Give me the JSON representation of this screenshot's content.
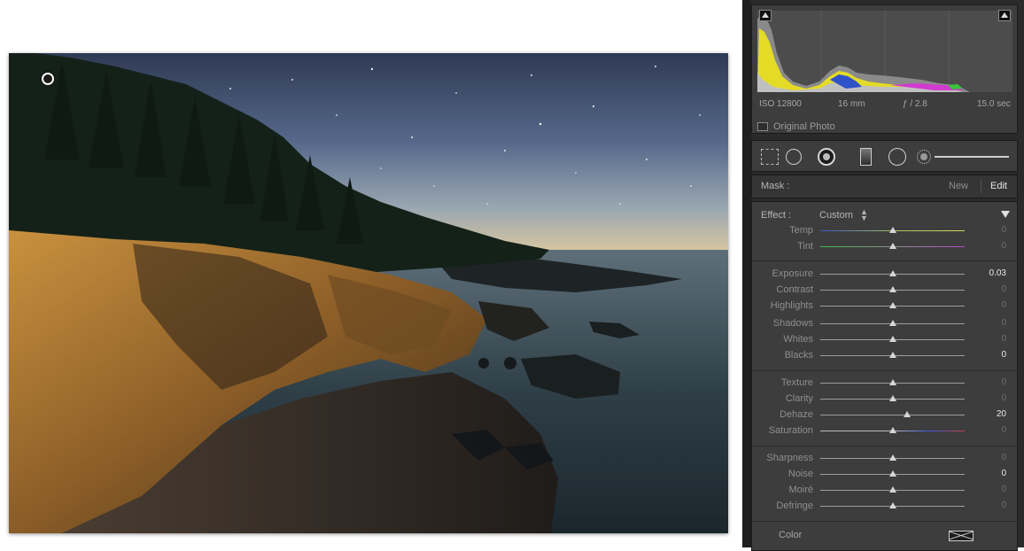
{
  "photo": {
    "description_icon": "photo-preview"
  },
  "histogram": {
    "iso": "ISO 12800",
    "focal": "16 mm",
    "aperture": "ƒ / 2.8",
    "shutter": "15.0 sec",
    "original_label": "Original Photo"
  },
  "tools": [
    "crop-icon",
    "spot-removal-icon",
    "red-eye-icon",
    "graduated-filter-icon",
    "radial-filter-icon",
    "brush-icon"
  ],
  "mask": {
    "label": "Mask :",
    "new": "New",
    "edit": "Edit"
  },
  "effect": {
    "label": "Effect :",
    "value": "Custom",
    "arrows": "⬍"
  },
  "sliders": {
    "temp": {
      "label": "Temp",
      "value": "0",
      "pos": 0.5
    },
    "tint": {
      "label": "Tint",
      "value": "0",
      "pos": 0.5
    },
    "exposure": {
      "label": "Exposure",
      "value": "0.03",
      "pos": 0.505
    },
    "contrast": {
      "label": "Contrast",
      "value": "0",
      "pos": 0.5
    },
    "highlights": {
      "label": "Highlights",
      "value": "0",
      "pos": 0.5
    },
    "shadows": {
      "label": "Shadows",
      "value": "0",
      "pos": 0.5
    },
    "whites": {
      "label": "Whites",
      "value": "0",
      "pos": 0.5
    },
    "blacks": {
      "label": "Blacks",
      "value": "0",
      "pos": 0.5
    },
    "texture": {
      "label": "Texture",
      "value": "0",
      "pos": 0.5
    },
    "clarity": {
      "label": "Clarity",
      "value": "0",
      "pos": 0.5
    },
    "dehaze": {
      "label": "Dehaze",
      "value": "20",
      "pos": 0.6
    },
    "saturation": {
      "label": "Saturation",
      "value": "0",
      "pos": 0.5
    },
    "sharpness": {
      "label": "Sharpness",
      "value": "0",
      "pos": 0.5
    },
    "noise": {
      "label": "Noise",
      "value": "0",
      "pos": 0.5
    },
    "moire": {
      "label": "Moiré",
      "value": "0",
      "pos": 0.5
    },
    "defringe": {
      "label": "Defringe",
      "value": "0",
      "pos": 0.5
    }
  },
  "color": {
    "label": "Color"
  }
}
